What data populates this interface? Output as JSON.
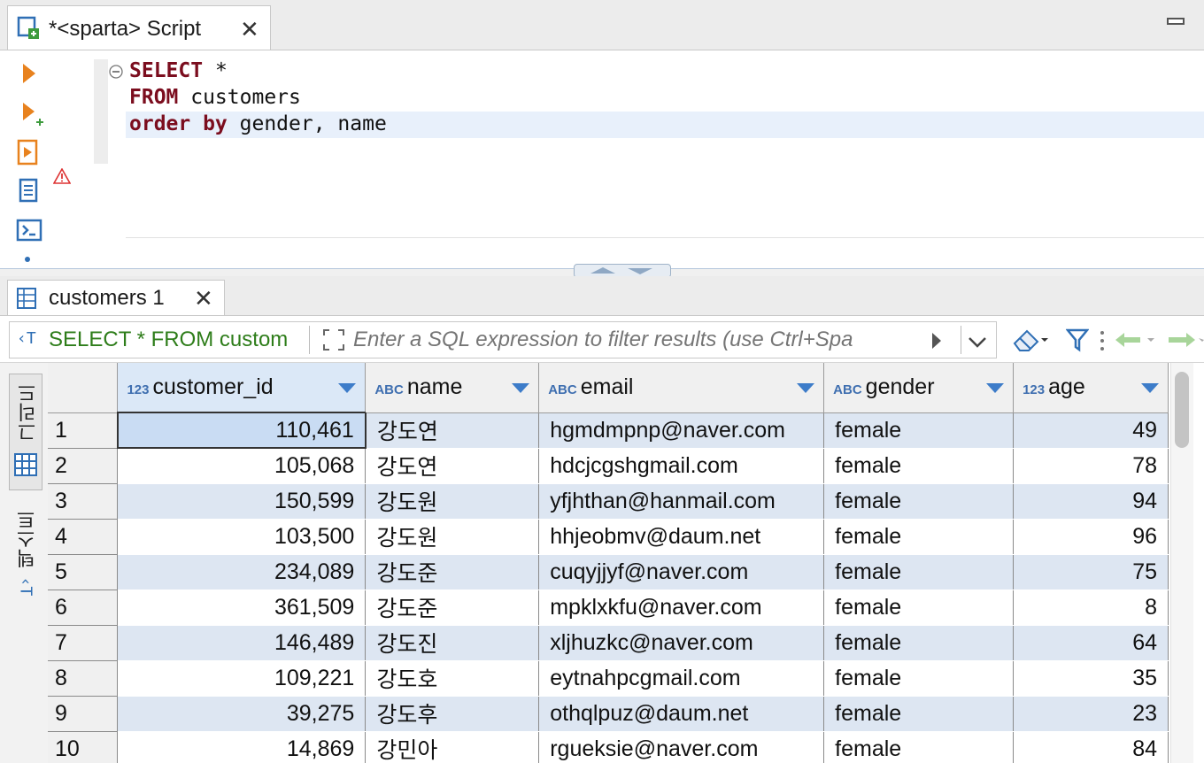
{
  "editor": {
    "tab_title": "*<sparta> Script",
    "code_lines": [
      [
        {
          "t": "SELECT",
          "k": true
        },
        {
          "t": " *",
          "k": false
        }
      ],
      [
        {
          "t": "FROM",
          "k": true
        },
        {
          "t": " customers",
          "k": false
        }
      ],
      [
        {
          "t": "order by",
          "k": true
        },
        {
          "t": " gender, name",
          "k": false
        }
      ]
    ]
  },
  "results": {
    "tab_title": "customers 1",
    "filter": {
      "query_label": "SELECT * FROM custom",
      "placeholder": "Enter a SQL expression to filter results (use Ctrl+Spa"
    },
    "side_tabs": {
      "grid": "그리드",
      "text": "텍스트"
    },
    "columns": [
      {
        "type": "123",
        "name": "customer_id"
      },
      {
        "type": "ABC",
        "name": "name"
      },
      {
        "type": "ABC",
        "name": "email"
      },
      {
        "type": "ABC",
        "name": "gender"
      },
      {
        "type": "123",
        "name": "age"
      }
    ],
    "rows": [
      [
        "1",
        "110,461",
        "강도연",
        "hgmdmpnp@naver.com",
        "female",
        "49"
      ],
      [
        "2",
        "105,068",
        "강도연",
        "hdcjcgshgmail.com",
        "female",
        "78"
      ],
      [
        "3",
        "150,599",
        "강도원",
        "yfjhthan@hanmail.com",
        "female",
        "94"
      ],
      [
        "4",
        "103,500",
        "강도원",
        "hhjeobmv@daum.net",
        "female",
        "96"
      ],
      [
        "5",
        "234,089",
        "강도준",
        "cuqyjjyf@naver.com",
        "female",
        "75"
      ],
      [
        "6",
        "361,509",
        "강도준",
        "mpklxkfu@naver.com",
        "female",
        "8"
      ],
      [
        "7",
        "146,489",
        "강도진",
        "xljhuzkc@naver.com",
        "female",
        "64"
      ],
      [
        "8",
        "109,221",
        "강도호",
        "eytnahpcgmail.com",
        "female",
        "35"
      ],
      [
        "9",
        "39,275",
        "강도후",
        "othqlpuz@daum.net",
        "female",
        "23"
      ],
      [
        "10",
        "14,869",
        "강민아",
        "rgueksie@naver.com",
        "female",
        "84"
      ]
    ]
  },
  "colors": {
    "keyword": "#7b0d1e",
    "accent": "#3d7cc9",
    "row_stripe": "#dde6f2",
    "filter_green": "#2e7d1a"
  }
}
